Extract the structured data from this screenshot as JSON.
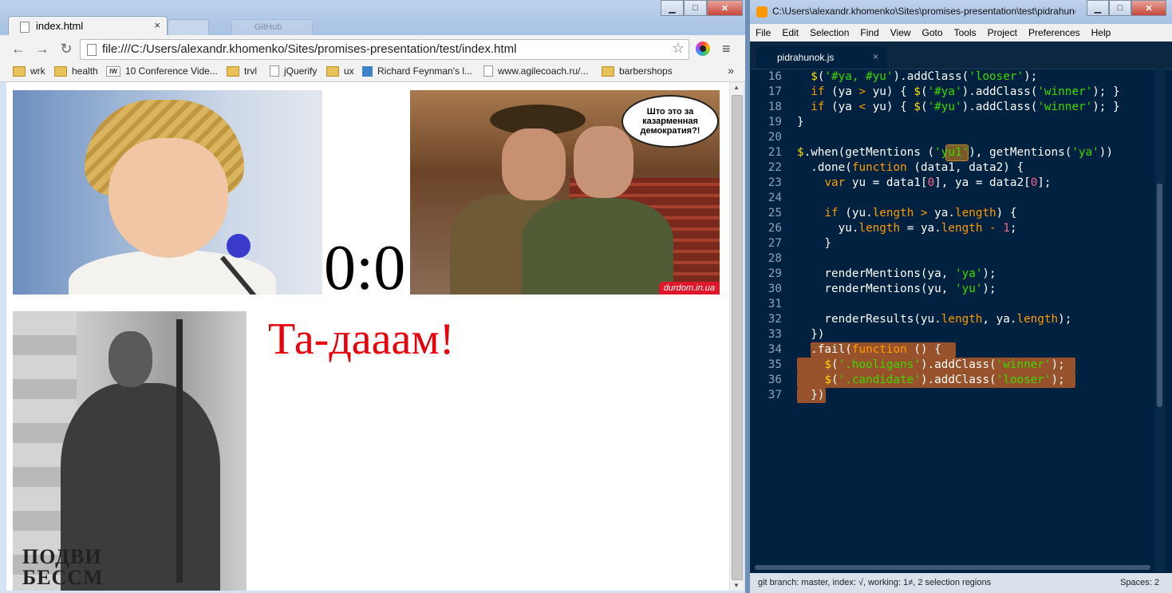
{
  "browser": {
    "tab_title": "index.html",
    "tab_close": "×",
    "ghost_tab": "GitHub",
    "url": "file:///C:/Users/alexandr.khomenko/Sites/promises-presentation/test/index.html",
    "bookmarks": [
      {
        "label": "wrk",
        "icon": "folder-icon"
      },
      {
        "label": "health",
        "icon": "folder-icon"
      },
      {
        "label": "10 Conference Vide...",
        "icon": "iw-icon"
      },
      {
        "label": "trvl",
        "icon": "folder-icon"
      },
      {
        "label": "jQuerify",
        "icon": "page-icon"
      },
      {
        "label": "ux",
        "icon": "folder-icon"
      },
      {
        "label": "Richard Feynman's l...",
        "icon": "feynman-icon"
      },
      {
        "label": "www.agilecoach.ru/...",
        "icon": "page-icon"
      },
      {
        "label": "barbershops",
        "icon": "folder-icon"
      }
    ],
    "bookmarks_more": "»",
    "page": {
      "score": "0:0",
      "speech_bubble": "Што это за казарменная демократия?!",
      "watermark": "durdom.in.ua",
      "poster_text_line1": "ПОДВИ",
      "poster_text_line2": "БЕССМ",
      "tadam": "Та-дааам!"
    }
  },
  "editor": {
    "window_title": "C:\\Users\\alexandr.khomenko\\Sites\\promises-presentation\\test\\pidrahunok.js",
    "menu": [
      "File",
      "Edit",
      "Selection",
      "Find",
      "View",
      "Goto",
      "Tools",
      "Project",
      "Preferences",
      "Help"
    ],
    "tab_name": "pidrahunok.js",
    "tab_close": "×",
    "line_numbers": [
      "16",
      "17",
      "18",
      "19",
      "20",
      "21",
      "22",
      "23",
      "24",
      "25",
      "26",
      "27",
      "28",
      "29",
      "30",
      "31",
      "32",
      "33",
      "34",
      "35",
      "36",
      "37"
    ],
    "status_left": "git branch: master, index: √, working: 1≠, 2 selection regions",
    "status_right": "Spaces: 2",
    "colors": {
      "background": "#002240",
      "keyword": "#ff9d00",
      "string": "#3ad900",
      "number": "#ff628c",
      "selection": "#97512b"
    }
  }
}
